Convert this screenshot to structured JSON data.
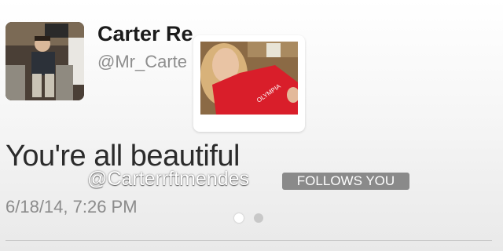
{
  "profile": {
    "display_name": "Carter Re",
    "handle": "@Mr_Carte"
  },
  "tweet": {
    "text": "You're all beautiful",
    "timestamp": "6/18/14, 7:26 PM"
  },
  "overlay": {
    "handle": "@Carterrftmendes",
    "follows_badge": "FOLLOWS YOU"
  },
  "pager": {
    "count": 2,
    "active_index": 0
  },
  "colors": {
    "badge_bg": "#8a8a8a",
    "name_text": "#1b1b1b",
    "muted_text": "#8e8e8e"
  }
}
